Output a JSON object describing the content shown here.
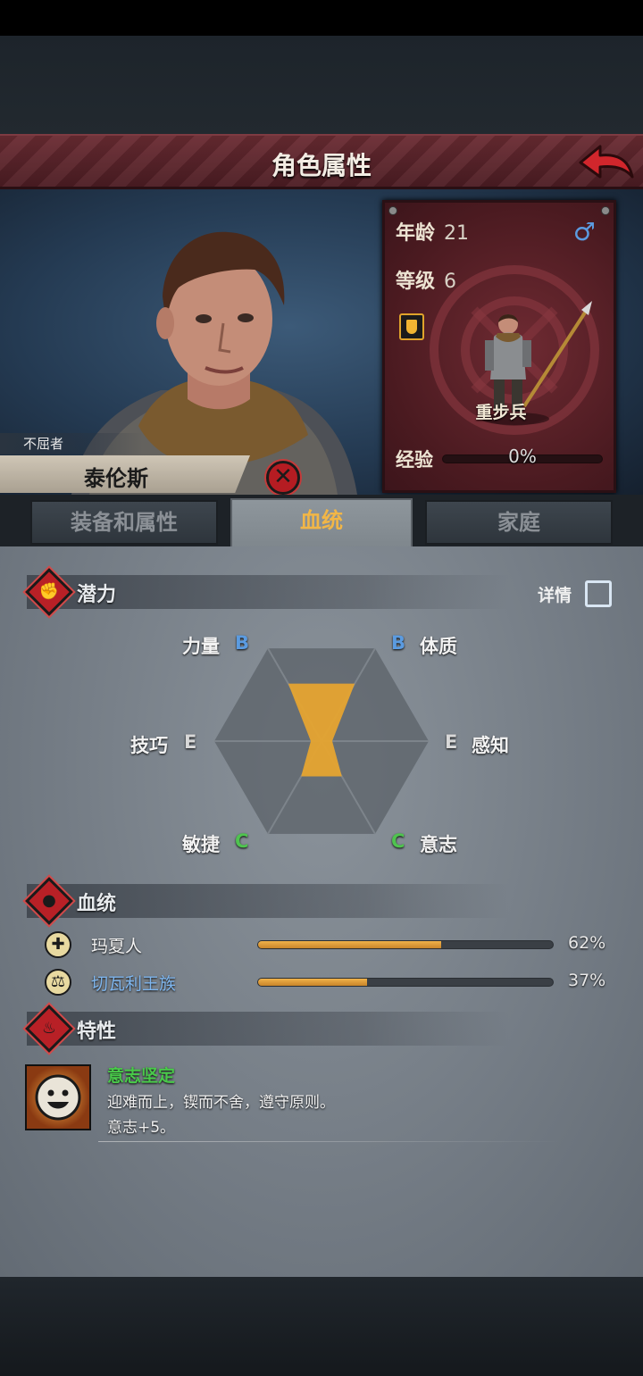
{
  "header": {
    "title": "角色属性",
    "back_icon": "red-back-arrow-icon"
  },
  "character": {
    "epithet": "不屈者",
    "name": "泰伦斯",
    "age_label": "年龄",
    "age": "21",
    "gender_symbol": "♂",
    "level_label": "等级",
    "level": "6",
    "class_name": "重步兵",
    "exp_label": "经验",
    "exp_percent": "0%",
    "exp_fraction": 0
  },
  "tabs": [
    {
      "label": "装备和属性",
      "active": false
    },
    {
      "label": "血统",
      "active": true
    },
    {
      "label": "家庭",
      "active": false
    }
  ],
  "potential": {
    "title": "潜力",
    "details_label": "详情",
    "attributes": [
      {
        "name": "力量",
        "grade": "B"
      },
      {
        "name": "体质",
        "grade": "B"
      },
      {
        "name": "感知",
        "grade": "E"
      },
      {
        "name": "意志",
        "grade": "C"
      },
      {
        "name": "敏捷",
        "grade": "C"
      },
      {
        "name": "技巧",
        "grade": "E"
      }
    ],
    "colors": {
      "B": "#5b9be0",
      "C": "#4fc34f",
      "E": "#d8d8d8",
      "fill": "#e6a430"
    }
  },
  "lineage": {
    "title": "血统",
    "items": [
      {
        "name": "玛夏人",
        "percent_text": "62%",
        "fraction": 0.62,
        "icon": "cross-shield-icon",
        "highlight": false
      },
      {
        "name": "切瓦利王族",
        "percent_text": "37%",
        "fraction": 0.37,
        "icon": "scales-icon",
        "highlight": true
      }
    ]
  },
  "traits": {
    "title": "特性",
    "items": [
      {
        "name": "意志坚定",
        "description": "迎难而上，锲而不舍，遵守原则。",
        "effect": "意志+5。",
        "icon": "smiling-face-icon"
      }
    ]
  }
}
